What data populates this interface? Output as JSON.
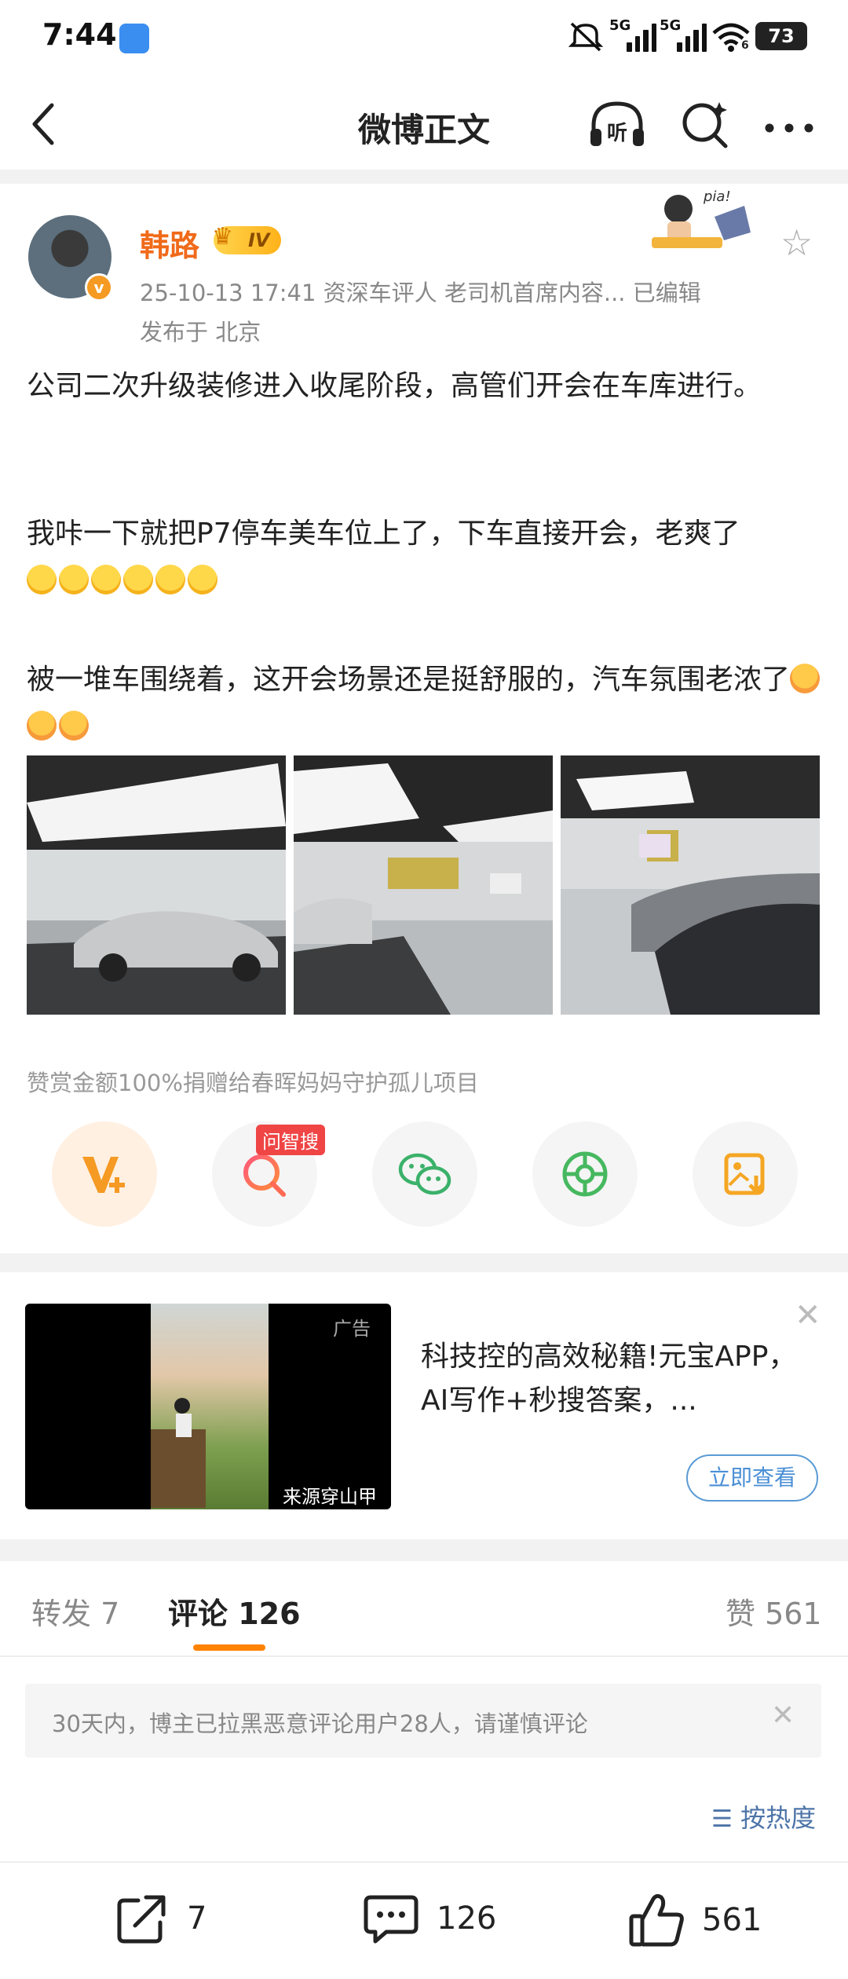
{
  "status_bar": {
    "time": "7:44",
    "network_1": "5G",
    "network_2": "5G",
    "wifi_sub": "6",
    "battery": "73"
  },
  "nav": {
    "title": "微博正文"
  },
  "post": {
    "author": "韩路",
    "level": "IV",
    "meta_line": "25-10-13 17:41   资深车评人 老司机首席内容...   已编辑",
    "location": "发布于 北京",
    "paragraph_1": "公司二次升级装修进入收尾阶段，高管们开会在车库进行。",
    "paragraph_2": "我咔一下就把P7停车美车位上了，下车直接开会，老爽了",
    "paragraph_3": "被一堆车围绕着，这开会场景还是挺舒服的，汽车氛围老浓了",
    "donate_text": "赞赏金额100%捐赠给春晖妈妈守护孤儿项目",
    "search_badge": "问智搜"
  },
  "ad": {
    "tag": "广告",
    "source": "来源穿山甲",
    "title": "科技控的高效秘籍!元宝APP，AI写作+秒搜答案，...",
    "button": "立即查看"
  },
  "tabs": {
    "repost": "转发 7",
    "comment": "评论 126",
    "like": "赞 561"
  },
  "notice": "30天内，博主已拉黑恶意评论用户28人，请谨慎评论",
  "sort_label": "按热度",
  "bottom_bar": {
    "repost_count": "7",
    "comment_count": "126",
    "like_count": "561"
  },
  "colors": {
    "accent": "#ff8200",
    "username": "#f06a1a",
    "link": "#4d74a8"
  },
  "icons": [
    "back-icon",
    "listen-icon",
    "smart-search-icon",
    "more-icon",
    "star-icon",
    "reward-icon",
    "wechat-icon",
    "moments-icon",
    "save-image-icon",
    "repost-icon",
    "comment-icon",
    "like-icon"
  ]
}
